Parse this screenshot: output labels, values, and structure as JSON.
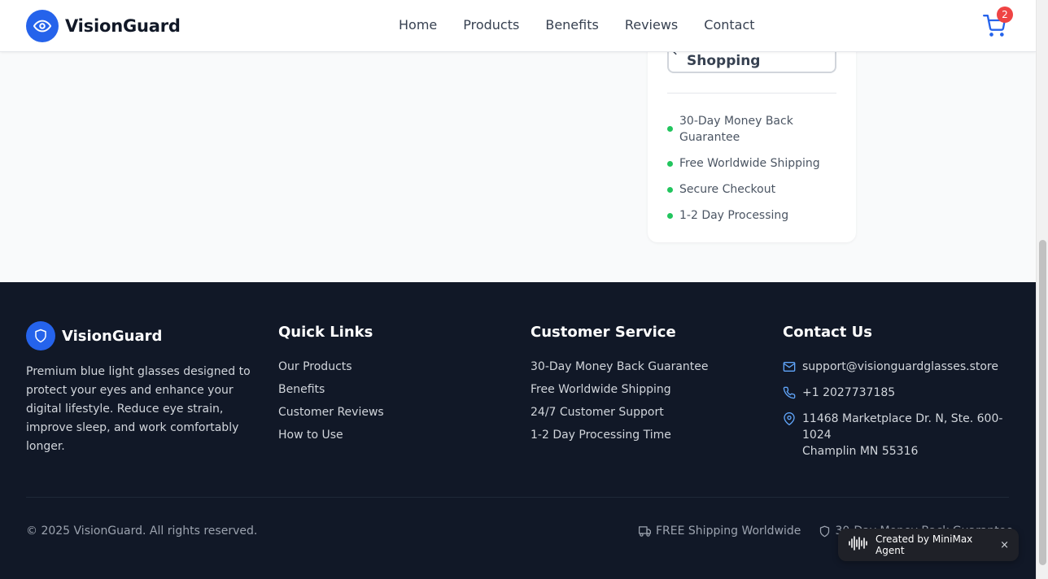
{
  "header": {
    "brand": "VisionGuard",
    "nav": [
      "Home",
      "Products",
      "Benefits",
      "Reviews",
      "Contact"
    ],
    "cart_count": "2"
  },
  "summary": {
    "continue_label": "Continue Shopping",
    "guarantees": [
      "30-Day Money Back Guarantee",
      "Free Worldwide Shipping",
      "Secure Checkout",
      "1-2 Day Processing"
    ]
  },
  "footer": {
    "brand": "VisionGuard",
    "description": "Premium blue light glasses designed to protect your eyes and enhance your digital lifestyle. Reduce eye strain, improve sleep, and work comfortably longer.",
    "quick_links": {
      "title": "Quick Links",
      "items": [
        "Our Products",
        "Benefits",
        "Customer Reviews",
        "How to Use"
      ]
    },
    "customer_service": {
      "title": "Customer Service",
      "items": [
        "30-Day Money Back Guarantee",
        "Free Worldwide Shipping",
        "24/7 Customer Support",
        "1-2 Day Processing Time"
      ]
    },
    "contact": {
      "title": "Contact Us",
      "email": "support@visionguardglasses.store",
      "phone": "+1 2027737185",
      "address_line1": "11468 Marketplace Dr. N, Ste. 600-1024",
      "address_line2": "Champlin MN 55316"
    },
    "copyright": "© 2025 VisionGuard. All rights reserved.",
    "badge_shipping": "FREE Shipping Worldwide",
    "badge_guarantee": "30-Day Money Back Guarantee"
  },
  "chip": {
    "label": "Created by MiniMax Agent",
    "close": "×"
  },
  "colors": {
    "brand": "#2563eb",
    "footer_bg": "#111827",
    "badge_red": "#ef4444",
    "check_green": "#22c55e"
  }
}
